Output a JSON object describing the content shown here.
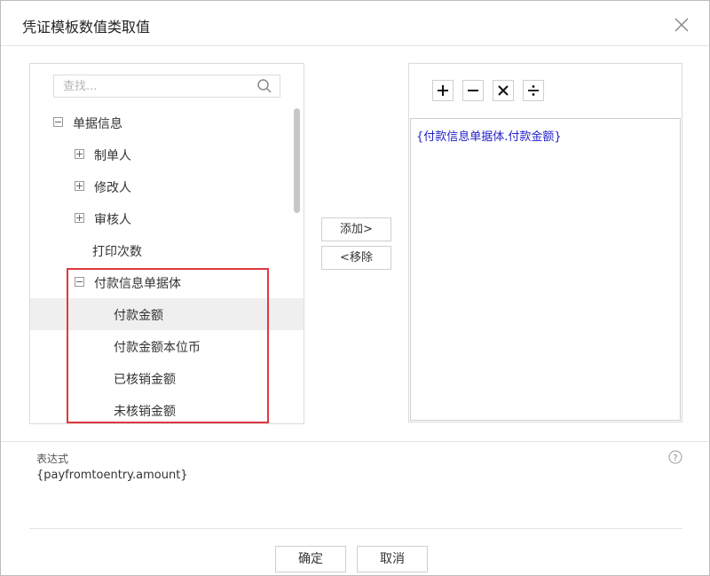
{
  "dialog": {
    "title": "凭证模板数值类取值"
  },
  "search": {
    "placeholder": "查找..."
  },
  "tree": [
    {
      "label": "单据信息",
      "toggle": "minus"
    },
    {
      "label": "制单人",
      "toggle": "plus"
    },
    {
      "label": "修改人",
      "toggle": "plus"
    },
    {
      "label": "审核人",
      "toggle": "plus"
    },
    {
      "label": "打印次数"
    },
    {
      "label": "付款信息单据体",
      "toggle": "minus"
    },
    {
      "label": "付款金额",
      "selected": true
    },
    {
      "label": "付款金额本位币"
    },
    {
      "label": "已核销金额"
    },
    {
      "label": "未核销金额"
    }
  ],
  "buttons": {
    "add": "添加>",
    "remove": "<移除",
    "ok": "确定",
    "cancel": "取消"
  },
  "operators": [
    "plus-icon",
    "minus-icon",
    "multiply-icon",
    "divide-icon"
  ],
  "editor": {
    "content": "{付款信息单据体.付款金额}"
  },
  "expression": {
    "label": "表达式",
    "value": "{payfromtoentry.amount}"
  },
  "colors": {
    "highlight": "#e0393e",
    "expression_text": "#2222cc"
  }
}
